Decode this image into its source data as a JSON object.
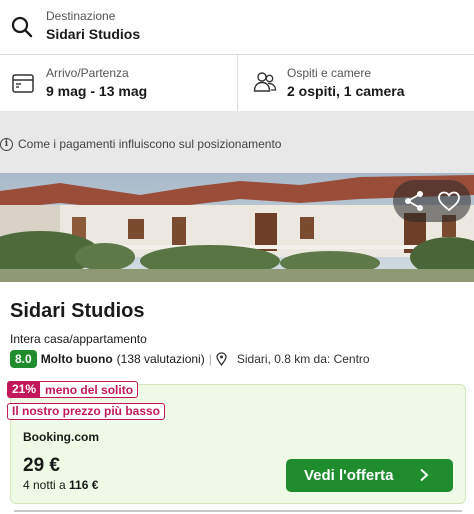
{
  "search": {
    "destination_label": "Destinazione",
    "destination_value": "Sidari Studios",
    "icon": "search-icon"
  },
  "dates": {
    "label": "Arrivo/Partenza",
    "value": "9 mag - 13 mag",
    "icon": "calendar-icon"
  },
  "guests": {
    "label": "Ospiti e camere",
    "value": "2 ospiti, 1 camera",
    "icon": "people-icon"
  },
  "info_notice": {
    "text": "Come i pagamenti influiscono sul posizionamento",
    "icon": "info-icon"
  },
  "hotel": {
    "name": "Sidari Studios",
    "type": "Intera casa/appartamento",
    "score": "8.0",
    "rating_word": "Molto buono",
    "rating_count": "(138 valutazioni)",
    "separator": "|",
    "location": "Sidari, 0.8 km da: Centro"
  },
  "offer": {
    "discount_pct": "21%",
    "discount_text": "meno del solito",
    "lowest_price_badge": "Il nostro prezzo più basso",
    "provider": "Booking.com",
    "price": "29 €",
    "nights_prefix": "4 notti a",
    "nights_total": "116 €",
    "cta_label": "Vedi l'offerta"
  },
  "colors": {
    "brand_green": "#1f8d2e",
    "badge_magenta": "#c2185b",
    "offer_bg": "#eef9e6"
  }
}
